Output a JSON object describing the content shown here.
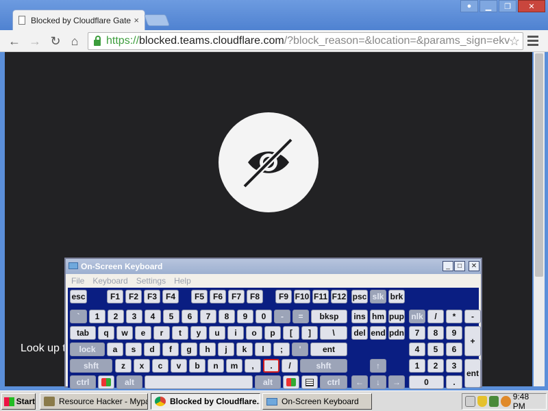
{
  "browser": {
    "tab_title": "Blocked by Cloudflare Gatew",
    "tab_close": "×",
    "url_scheme": "https://",
    "url_host": "blocked.teams.cloudflare.com",
    "url_path": "/?block_reason=&location=&params_sign=ekv",
    "nav_back": "←",
    "nav_forward": "→",
    "nav_reload": "↻",
    "nav_home": "⌂",
    "star": "☆",
    "window_controls": [
      "▁",
      "❐",
      "✕"
    ]
  },
  "page": {
    "partial_text": "Look up t"
  },
  "osk": {
    "title": "On-Screen Keyboard",
    "menu": [
      "File",
      "Keyboard",
      "Settings",
      "Help"
    ],
    "controls": [
      "_",
      "□",
      "✕"
    ]
  },
  "keys": {
    "row0": [
      "esc",
      "F1",
      "F2",
      "F3",
      "F4",
      "F5",
      "F6",
      "F7",
      "F8",
      "F9",
      "F10",
      "F11",
      "F12",
      "psc",
      "slk",
      "brk"
    ],
    "row1": [
      "`",
      "1",
      "2",
      "3",
      "4",
      "5",
      "6",
      "7",
      "8",
      "9",
      "0",
      "-",
      "=",
      "bksp",
      "ins",
      "hm",
      "pup",
      "nlk",
      "/",
      "*",
      "-"
    ],
    "row2": [
      "tab",
      "q",
      "w",
      "e",
      "r",
      "t",
      "y",
      "u",
      "i",
      "o",
      "p",
      "[",
      "]",
      "\\",
      "del",
      "end",
      "pdn",
      "7",
      "8",
      "9",
      "+"
    ],
    "row3": [
      "lock",
      "a",
      "s",
      "d",
      "f",
      "g",
      "h",
      "j",
      "k",
      "l",
      ";",
      "'",
      "ent",
      "4",
      "5",
      "6"
    ],
    "row4": [
      "shft",
      "z",
      "x",
      "c",
      "v",
      "b",
      "n",
      "m",
      ",",
      ".",
      "/",
      "shft",
      "↑",
      "1",
      "2",
      "3",
      "ent"
    ],
    "row5": [
      "ctrl",
      "alt",
      "alt",
      "ctrl",
      "←",
      "↓",
      "→",
      "0",
      "."
    ]
  },
  "taskbar": {
    "start": "Start",
    "tasks": [
      "Resource Hacker - Mypal",
      "Blocked by Cloudflare...",
      "On-Screen Keyboard"
    ],
    "clock": "9:48 PM"
  },
  "colors": {
    "page_bg": "#222224",
    "keyboard_bg": "#0a1e82",
    "accent": "#5b8fd9"
  }
}
